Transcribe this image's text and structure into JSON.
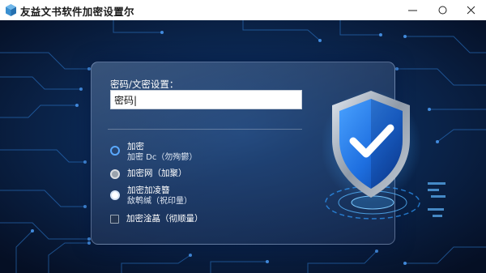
{
  "window": {
    "title": "友益文书软件加密设置尔"
  },
  "title_buttons": {
    "minimize_glyph": "—",
    "maximize_glyph": "○",
    "close_glyph": "✕"
  },
  "form": {
    "password_label": "密码/文密设置：",
    "password_value": "密码|"
  },
  "options": [
    {
      "line1": "加密",
      "line2": "加密 Dc（勿殉鬱）",
      "state": "ring"
    },
    {
      "line1": "加密网（加聚）",
      "state": "grey"
    },
    {
      "line1": "加密加凌簪",
      "line2": "敌鹎缄（祝印量）",
      "state": "white"
    },
    {
      "line1": "加密淦蕌（彻顺量）",
      "state": "checkbox"
    }
  ],
  "icons": {
    "app": "app-cube-icon",
    "shield": "shield-check-icon"
  },
  "colors": {
    "background": "#07152f",
    "circuit": "#2f7fd6",
    "accent": "#5aa9ff",
    "shield": "#1e6fe0"
  }
}
